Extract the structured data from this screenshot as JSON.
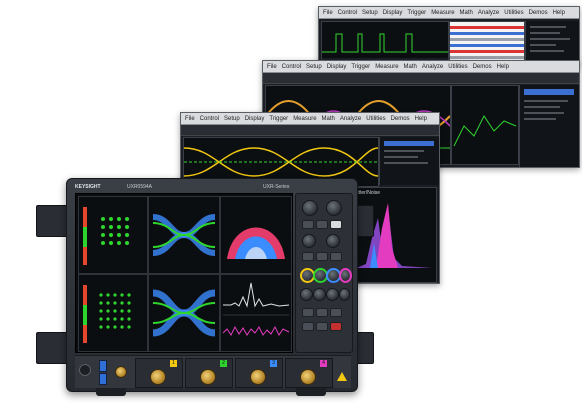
{
  "screens": {
    "back": {
      "menu": [
        "File",
        "Control",
        "Setup",
        "Display",
        "Trigger",
        "Measure",
        "Math",
        "Analyze",
        "Utilities",
        "Demos",
        "Help"
      ]
    },
    "middle": {
      "menu": [
        "File",
        "Control",
        "Setup",
        "Display",
        "Trigger",
        "Measure",
        "Math",
        "Analyze",
        "Utilities",
        "Demos",
        "Help"
      ]
    },
    "front": {
      "menu": [
        "File",
        "Control",
        "Setup",
        "Display",
        "Trigger",
        "Measure",
        "Math",
        "Analyze",
        "Utilities",
        "Demos",
        "Help"
      ],
      "panel_title": "Jitter/Noise",
      "side_title": "Measurements"
    }
  },
  "instrument": {
    "brand": "KEYSIGHT",
    "model_text": "UXR0594A",
    "series_text": "UXR-Series",
    "colors": {
      "ch1": "#f2c811",
      "ch2": "#2fd52f",
      "ch3": "#3b8cff",
      "ch4": "#e43cc0"
    },
    "channel_labels": [
      "1",
      "2",
      "3",
      "4"
    ]
  }
}
